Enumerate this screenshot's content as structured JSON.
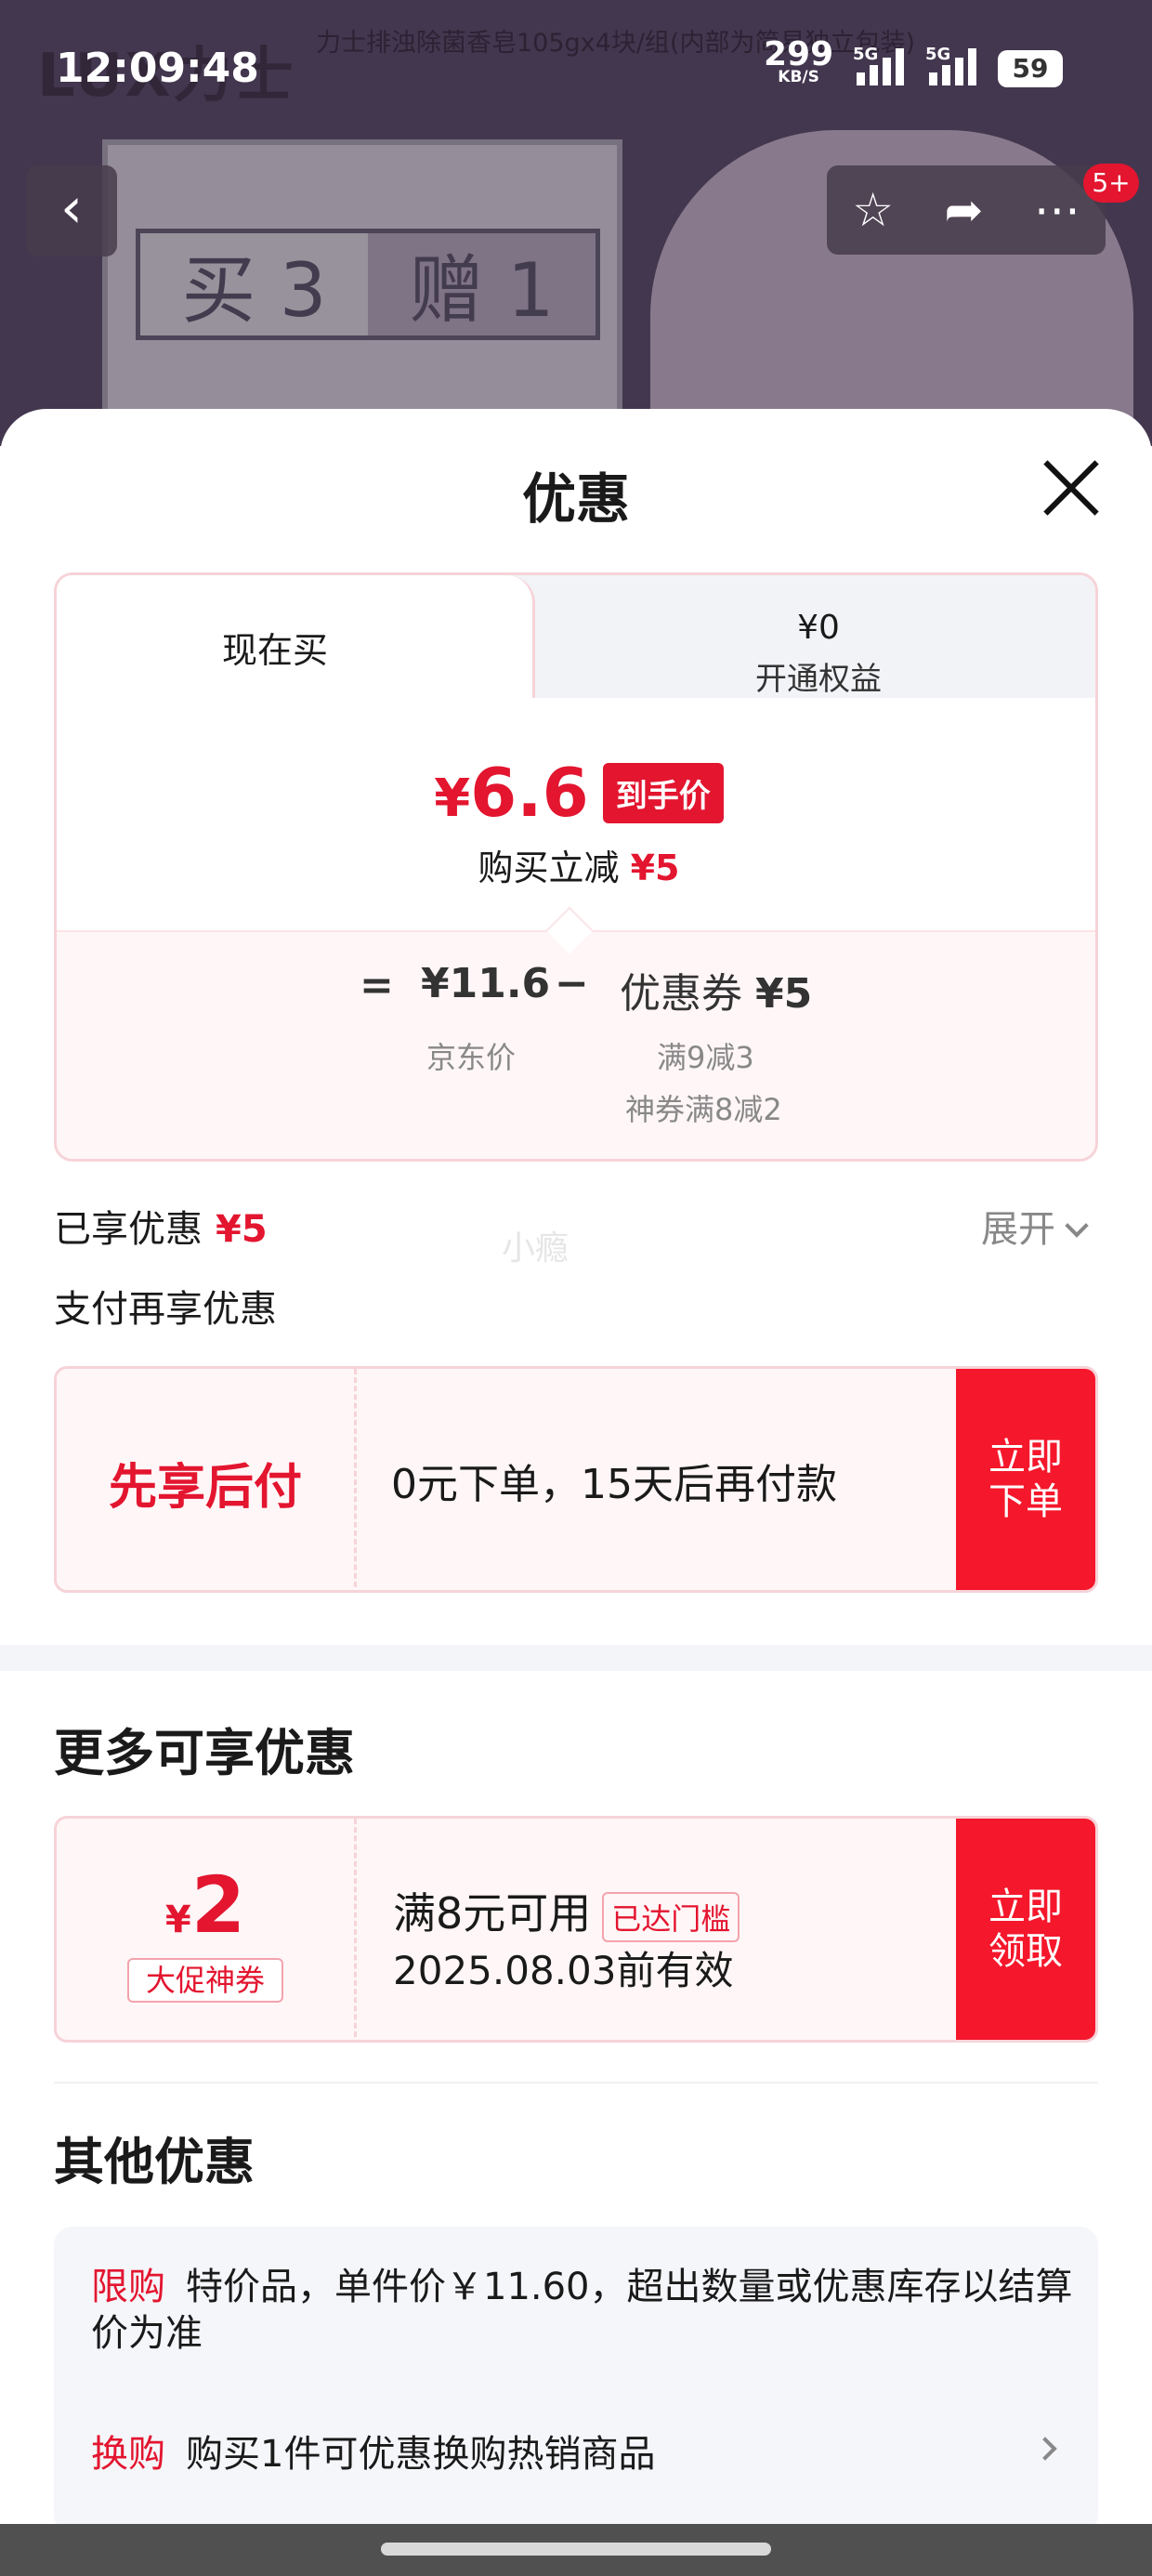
{
  "status_bar": {
    "time": "12:09:48",
    "net_speed": "299",
    "net_unit": "KB/S",
    "net_type_1": "5G",
    "net_type_2": "5G",
    "battery": "59"
  },
  "background_page": {
    "brand": "LUX力士",
    "product_title": "力士排浊除菌香皂105gx4块/组(内部为简易独立包装)",
    "promo_left": "买 3",
    "promo_right": "赠 1",
    "notification_count": "5+"
  },
  "sheet": {
    "title": "优惠",
    "tabs": {
      "current": "现在买",
      "other_price": "¥0",
      "other_label": "开通权益"
    },
    "final_price": {
      "currency": "¥",
      "amount": "6.6",
      "tag": "到手价",
      "reduce_label": "购买立减",
      "reduce_amount": "¥5"
    },
    "formula": {
      "eq": "=",
      "jd_price": "¥11.6",
      "minus": "−",
      "coupon_label": "优惠券",
      "coupon_amount": "¥5",
      "jd_label": "京东价",
      "coupon_rule_1": "满9减3",
      "coupon_rule_2": "神券满8减2"
    },
    "enjoyed": {
      "label": "已享优惠",
      "amount": "¥5",
      "expand": "展开"
    },
    "watermark": "小瘾",
    "pay_more_title": "支付再享优惠",
    "pay_card": {
      "left": "先享后付",
      "text": "0元下单，15天后再付款",
      "button_line1": "立即",
      "button_line2": "下单"
    },
    "more_title": "更多可享优惠",
    "coupon": {
      "currency": "¥",
      "amount": "2",
      "tag": "大促神券",
      "condition": "满8元可用",
      "badge": "已达门槛",
      "valid": "2025.08.03前有效",
      "button_line1": "立即",
      "button_line2": "领取"
    },
    "other_title": "其他优惠",
    "other": {
      "limit_tag": "限购",
      "limit_text": "特价品，单件价￥11.60，超出数量或优惠库存以结算价为准",
      "swap_tag": "换购",
      "swap_text": "购买1件可优惠换购热销商品"
    }
  },
  "colors": {
    "accent_red": "#e3152f",
    "button_red": "#f5172b",
    "card_border": "#f6d3d8",
    "card_bg": "#fff6f7"
  }
}
